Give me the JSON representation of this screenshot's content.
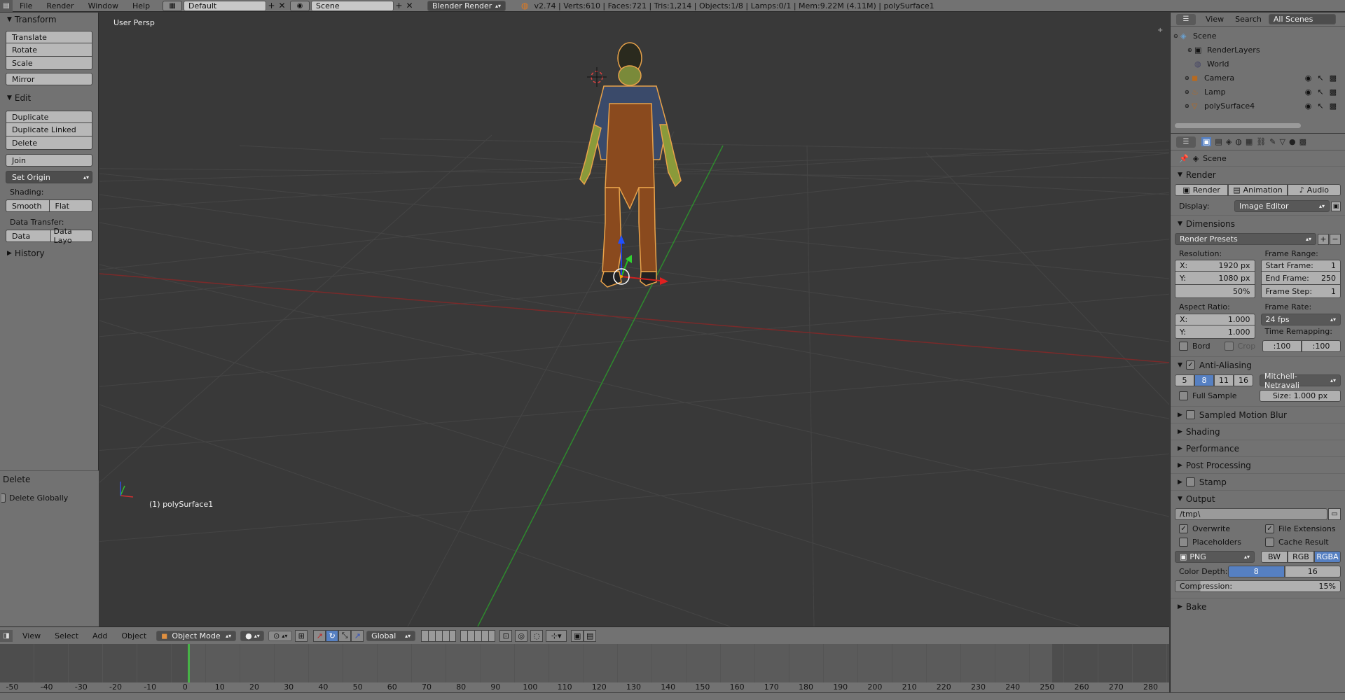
{
  "topbar": {
    "menus": [
      "File",
      "Render",
      "Window",
      "Help"
    ],
    "layout_name": "Default",
    "scene_name": "Scene",
    "engine": "Blender Render",
    "stats": "v2.74 | Verts:610 | Faces:721 | Tris:1,214 | Objects:1/8 | Lamps:0/1 | Mem:9.22M (4.11M) | polySurface1"
  },
  "toolshelf": {
    "transform": {
      "title": "Transform",
      "buttons": [
        "Translate",
        "Rotate",
        "Scale",
        "Mirror"
      ]
    },
    "edit": {
      "title": "Edit",
      "buttons": [
        "Duplicate",
        "Duplicate Linked",
        "Delete",
        "Join"
      ],
      "set_origin": "Set Origin"
    },
    "shading": {
      "label": "Shading:",
      "smooth": "Smooth",
      "flat": "Flat"
    },
    "data_transfer": {
      "label": "Data Transfer:",
      "data": "Data",
      "data_layout": "Data Layo"
    },
    "history": {
      "title": "History"
    },
    "operator": {
      "title": "Delete",
      "checkbox": "Delete Globally"
    }
  },
  "viewport": {
    "view_label": "User Persp",
    "object_label": "(1) polySurface1"
  },
  "outliner": {
    "tabs": [
      "View",
      "Search",
      "All Scenes"
    ],
    "items": [
      {
        "label": "Scene",
        "icon": "scene-icon"
      },
      {
        "label": "RenderLayers",
        "icon": "renderlayers-icon"
      },
      {
        "label": "World",
        "icon": "world-icon"
      },
      {
        "label": "Camera",
        "icon": "camera-icon"
      },
      {
        "label": "Lamp",
        "icon": "lamp-icon"
      },
      {
        "label": "polySurface4",
        "icon": "mesh-icon"
      }
    ]
  },
  "properties": {
    "breadcrumb": "Scene",
    "render": {
      "title": "Render",
      "render_btn": "Render",
      "animation_btn": "Animation",
      "audio_btn": "Audio",
      "display_label": "Display:",
      "display_value": "Image Editor"
    },
    "dimensions": {
      "title": "Dimensions",
      "presets": "Render Presets",
      "resolution_label": "Resolution:",
      "res_x_label": "X:",
      "res_x": "1920 px",
      "res_y_label": "Y:",
      "res_y": "1080 px",
      "res_pct": "50%",
      "frame_range_label": "Frame Range:",
      "start_label": "Start Frame:",
      "start": "1",
      "end_label": "End Frame:",
      "end": "250",
      "step_label": "Frame Step:",
      "step": "1",
      "aspect_label": "Aspect Ratio:",
      "asp_x": "1.000",
      "asp_y": "1.000",
      "frame_rate_label": "Frame Rate:",
      "frame_rate": "24 fps",
      "time_remap_label": "Time Remapping:",
      "remap_old": ":100",
      "remap_new": ":100",
      "bord": "Bord",
      "crop": "Crop"
    },
    "antialiasing": {
      "title": "Anti-Aliasing",
      "samples": [
        "5",
        "8",
        "11",
        "16"
      ],
      "filter": "Mitchell-Netravali",
      "full_sample": "Full Sample",
      "size": "Size:  1.000 px"
    },
    "collapsed": [
      "Sampled Motion Blur",
      "Shading",
      "Performance",
      "Post Processing",
      "Stamp"
    ],
    "output": {
      "title": "Output",
      "path": "/tmp\\",
      "overwrite": "Overwrite",
      "file_ext": "File Extensions",
      "placeholders": "Placeholders",
      "cache": "Cache Result",
      "format": "PNG",
      "bw": "BW",
      "rgb": "RGB",
      "rgba": "RGBA",
      "depth_label": "Color Depth:",
      "depth8": "8",
      "depth16": "16",
      "compression": "Compression:",
      "compression_val": "15%"
    },
    "bake": {
      "title": "Bake"
    }
  },
  "view3d_header": {
    "menus": [
      "View",
      "Select",
      "Add",
      "Object"
    ],
    "mode": "Object Mode",
    "orientation": "Global"
  },
  "timeline": {
    "ticks": [
      "-50",
      "-40",
      "-30",
      "-20",
      "-10",
      "0",
      "10",
      "20",
      "30",
      "40",
      "50",
      "60",
      "70",
      "80",
      "90",
      "100",
      "110",
      "120",
      "130",
      "140",
      "150",
      "160",
      "170",
      "180",
      "190",
      "200",
      "210",
      "220",
      "230",
      "240",
      "250",
      "260",
      "270",
      "280"
    ],
    "current_frame": "0"
  }
}
